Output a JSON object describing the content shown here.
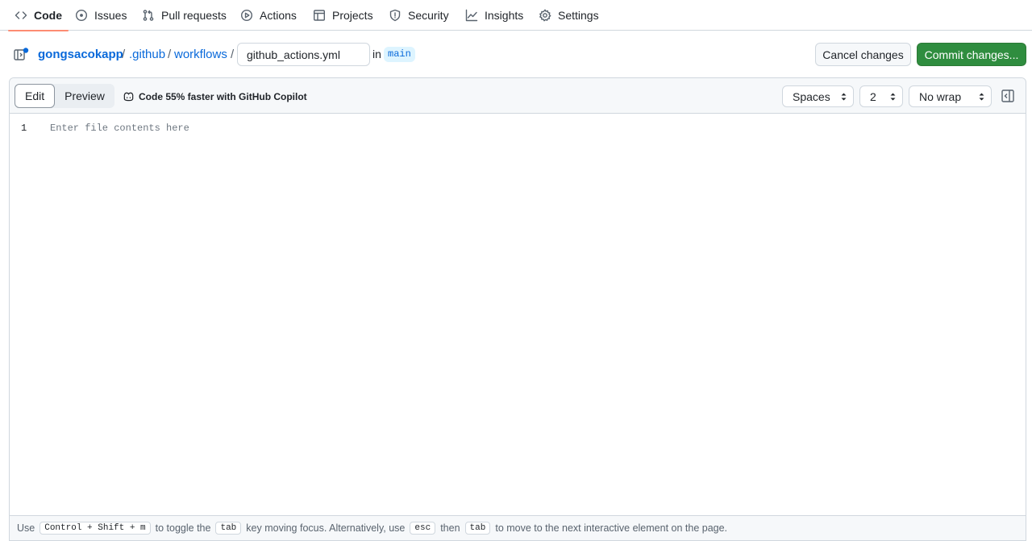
{
  "nav": {
    "tabs": [
      {
        "label": "Code",
        "icon": "code-icon",
        "active": true
      },
      {
        "label": "Issues",
        "icon": "issue-icon"
      },
      {
        "label": "Pull requests",
        "icon": "pull-request-icon"
      },
      {
        "label": "Actions",
        "icon": "play-icon"
      },
      {
        "label": "Projects",
        "icon": "table-icon"
      },
      {
        "label": "Security",
        "icon": "shield-icon"
      },
      {
        "label": "Insights",
        "icon": "graph-icon"
      },
      {
        "label": "Settings",
        "icon": "gear-icon"
      }
    ]
  },
  "breadcrumb": {
    "repo": "gongsacokapp",
    "sep": "/",
    "dir1": ".github",
    "dir2": "workflows",
    "filename": "github_actions.yml",
    "in_label": "in",
    "branch": "main"
  },
  "actions": {
    "cancel": "Cancel changes",
    "commit": "Commit changes..."
  },
  "editor": {
    "tabs": {
      "edit": "Edit",
      "preview": "Preview"
    },
    "copilot": "Code 55% faster with GitHub Copilot",
    "indent_mode": "Spaces",
    "indent_size": "2",
    "wrap_mode": "No wrap",
    "line_number": "1",
    "placeholder": "Enter file contents here"
  },
  "footer": {
    "t1": "Use",
    "k1": "Control + Shift + m",
    "t2": "to toggle the",
    "k2": "tab",
    "t3": "key moving focus. Alternatively, use",
    "k3": "esc",
    "t4": "then",
    "k4": "tab",
    "t5": "to move to the next interactive element on the page."
  },
  "colors": {
    "accent_link": "#0969da",
    "commit_green": "#2f8d3f",
    "active_tab_underline": "#fd8c73"
  }
}
